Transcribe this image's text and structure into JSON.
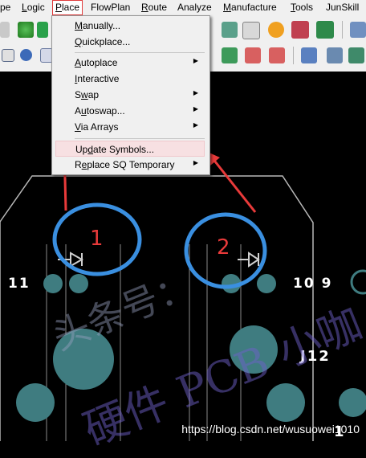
{
  "menubar": {
    "items": [
      {
        "label": "pe",
        "key": ""
      },
      {
        "label": "ogic",
        "key": "L"
      },
      {
        "label": "lace",
        "key": "P"
      },
      {
        "label": "FlowPlan",
        "key": ""
      },
      {
        "label": "oute",
        "key": "R"
      },
      {
        "label": "Analyze",
        "key": ""
      },
      {
        "label": "anufacture",
        "key": "M"
      },
      {
        "label": "ools",
        "key": "T"
      },
      {
        "label": "JunSkill",
        "key": ""
      }
    ]
  },
  "dropdown": {
    "items": [
      {
        "key": "M",
        "rest": "anually...",
        "submenu": false
      },
      {
        "key": "Q",
        "rest": "uickplace...",
        "submenu": false
      },
      {
        "key": "A",
        "rest": "utoplace",
        "submenu": true
      },
      {
        "key": "I",
        "rest": "nteractive",
        "submenu": false
      },
      {
        "key": "w",
        "pre": "S",
        "rest": "ap",
        "submenu": true
      },
      {
        "key": "u",
        "pre": "A",
        "rest": "toswap...",
        "submenu": true
      },
      {
        "key": "V",
        "rest": "ia Arrays",
        "submenu": true
      },
      {
        "key": "d",
        "pre": "Up",
        "rest": "ate Symbols...",
        "submenu": false
      },
      {
        "key": "e",
        "pre": "R",
        "rest": "place SQ Temporary",
        "submenu": true
      }
    ]
  },
  "canvas": {
    "labels": {
      "left": "11",
      "right": "10 9",
      "ref": "J12",
      "bottom": "1"
    },
    "callouts": [
      "1",
      "2"
    ],
    "watermark_cn": "头条号：",
    "watermark_line2": "硬件 PCB 小咖",
    "url": "https://blog.csdn.net/wusuowei1010"
  },
  "colors": {
    "callout": "#e83a3a",
    "ring": "#3a8fe0",
    "pad": "#3f7c80",
    "menu_hl": "#f7e0e2"
  }
}
